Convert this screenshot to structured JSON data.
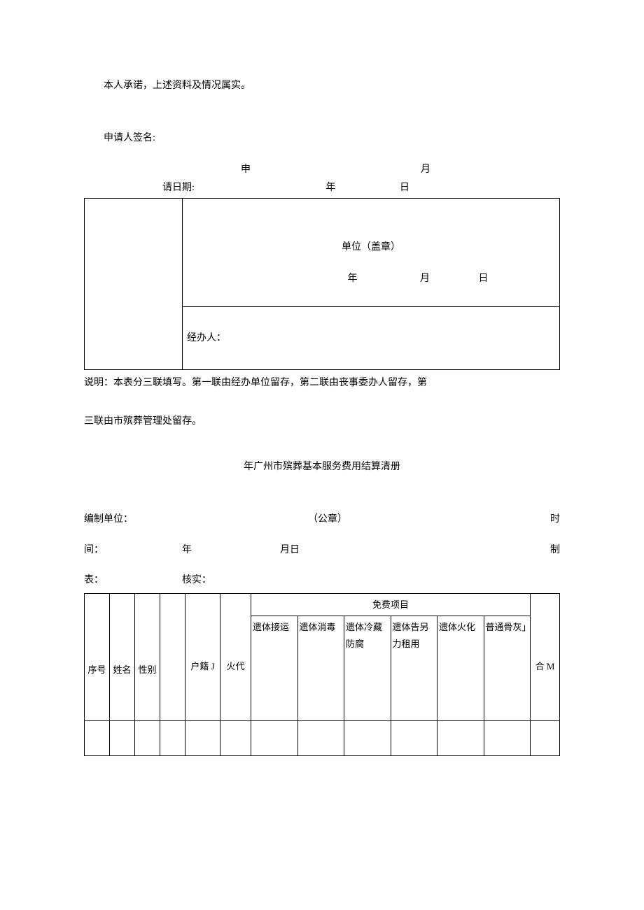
{
  "declaration": "本人承诺，上述资料及情况属实。",
  "applicant_sig_label": "申请人签名:",
  "apply_date": {
    "label": "申请日期:",
    "year": "年",
    "month_day": "月日"
  },
  "stamp_block": {
    "unit_seal": "单位（盖章）",
    "year": "年",
    "month": "月",
    "day": "日",
    "handler_label": "经办人："
  },
  "note_line1": "说明：本表分三联填写。第一联由经办单位留存，第二联由丧事委办人留存，第",
  "note_line2": "三联由市殡葬管理处留存。",
  "title2": "年广州市殡葬基本服务费用结算清册",
  "meta": {
    "prep_unit_label": "编制单位：",
    "seal_label": "（公章）",
    "time_label_right": "时",
    "time_label_left": "间：",
    "year": "年",
    "month_day": "月日",
    "prep_right": "制",
    "table_label": "表：",
    "verify_label": "核实："
  },
  "table2": {
    "seq": "序号",
    "name": "姓名",
    "sex": "性别",
    "huji": "户籍 J",
    "huodai": "火代",
    "free_header": "免费项目",
    "c1": "遗体接运",
    "c2": "遗体消毒",
    "c3": "遗体冷藏防腐",
    "c4": "遗体告另力租用",
    "c5": "遗体火化",
    "c6": "普通骨灰」",
    "total": "合 M"
  }
}
